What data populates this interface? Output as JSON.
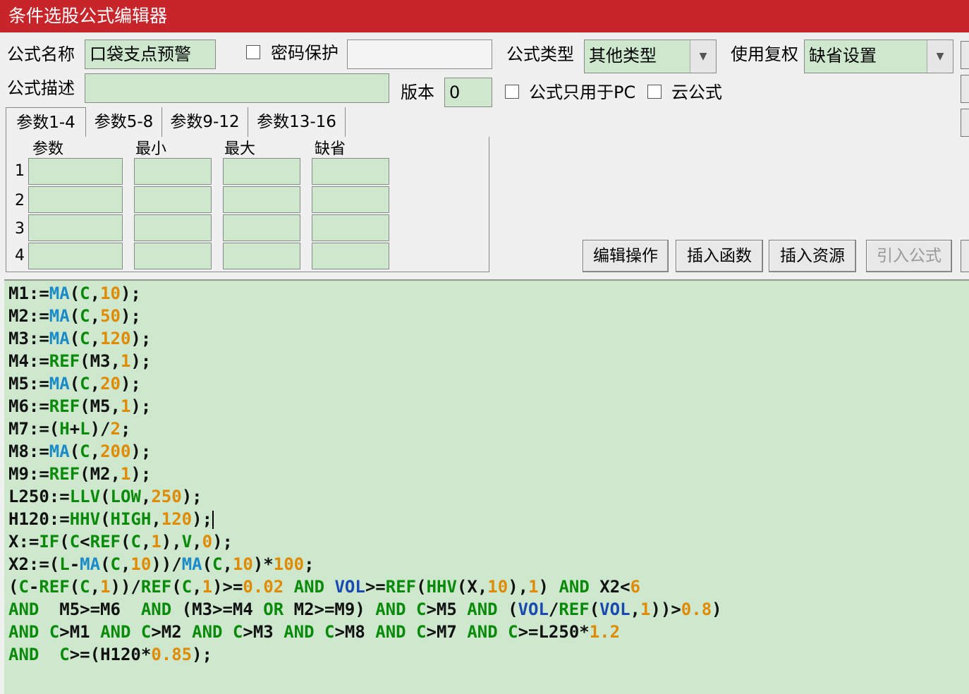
{
  "window": {
    "title": "条件选股公式编辑器"
  },
  "form": {
    "name_label": "公式名称",
    "name_value": "口袋支点预警",
    "password_label": "密码保护",
    "type_label": "公式类型",
    "type_value": "其他类型",
    "rights_label": "使用复权",
    "rights_value": "缺省设置",
    "desc_label": "公式描述",
    "desc_value": "",
    "version_label": "版本",
    "version_value": "0",
    "pc_only_label": "公式只用于PC",
    "cloud_label": "云公式"
  },
  "tabs": [
    "参数1-4",
    "参数5-8",
    "参数9-12",
    "参数13-16"
  ],
  "params": {
    "headers": [
      "参数",
      "最小",
      "最大",
      "缺省"
    ],
    "rows": [
      "1",
      "2",
      "3",
      "4"
    ]
  },
  "buttons": {
    "edit": "编辑操作",
    "insert_func": "插入函数",
    "insert_res": "插入资源",
    "import": "引入公式"
  },
  "code_lines": [
    [
      [
        "M1:=",
        "k"
      ],
      [
        "MA",
        "c"
      ],
      [
        "(",
        "k"
      ],
      [
        "C",
        "g"
      ],
      [
        ",",
        "k"
      ],
      [
        "10",
        "o"
      ],
      [
        ");",
        "k"
      ]
    ],
    [
      [
        "M2:=",
        "k"
      ],
      [
        "MA",
        "c"
      ],
      [
        "(",
        "k"
      ],
      [
        "C",
        "g"
      ],
      [
        ",",
        "k"
      ],
      [
        "50",
        "o"
      ],
      [
        ");",
        "k"
      ]
    ],
    [
      [
        "M3:=",
        "k"
      ],
      [
        "MA",
        "c"
      ],
      [
        "(",
        "k"
      ],
      [
        "C",
        "g"
      ],
      [
        ",",
        "k"
      ],
      [
        "120",
        "o"
      ],
      [
        ");",
        "k"
      ]
    ],
    [
      [
        "M4:=",
        "k"
      ],
      [
        "REF",
        "g"
      ],
      [
        "(M3,",
        "k"
      ],
      [
        "1",
        "o"
      ],
      [
        ");",
        "k"
      ]
    ],
    [
      [
        "M5:=",
        "k"
      ],
      [
        "MA",
        "c"
      ],
      [
        "(",
        "k"
      ],
      [
        "C",
        "g"
      ],
      [
        ",",
        "k"
      ],
      [
        "20",
        "o"
      ],
      [
        ");",
        "k"
      ]
    ],
    [
      [
        "M6:=",
        "k"
      ],
      [
        "REF",
        "g"
      ],
      [
        "(M5,",
        "k"
      ],
      [
        "1",
        "o"
      ],
      [
        ");",
        "k"
      ]
    ],
    [
      [
        "M7:=(",
        "k"
      ],
      [
        "H",
        "g"
      ],
      [
        "+",
        "k"
      ],
      [
        "L",
        "g"
      ],
      [
        ")/",
        "k"
      ],
      [
        "2",
        "o"
      ],
      [
        ";",
        "k"
      ]
    ],
    [
      [
        "M8:=",
        "k"
      ],
      [
        "MA",
        "c"
      ],
      [
        "(",
        "k"
      ],
      [
        "C",
        "g"
      ],
      [
        ",",
        "k"
      ],
      [
        "200",
        "o"
      ],
      [
        ");",
        "k"
      ]
    ],
    [
      [
        "M9:=",
        "k"
      ],
      [
        "REF",
        "g"
      ],
      [
        "(M2,",
        "k"
      ],
      [
        "1",
        "o"
      ],
      [
        ");",
        "k"
      ]
    ],
    [
      [
        "L250:=",
        "k"
      ],
      [
        "LLV",
        "g"
      ],
      [
        "(",
        "k"
      ],
      [
        "LOW",
        "g"
      ],
      [
        ",",
        "k"
      ],
      [
        "250",
        "o"
      ],
      [
        ");",
        "k"
      ]
    ],
    [
      [
        "H120:=",
        "k"
      ],
      [
        "HHV",
        "g"
      ],
      [
        "(",
        "k"
      ],
      [
        "HIGH",
        "g"
      ],
      [
        ",",
        "k"
      ],
      [
        "120",
        "o"
      ],
      [
        ");",
        "k"
      ]
    ],
    [
      [
        "X:=",
        "k"
      ],
      [
        "IF",
        "g"
      ],
      [
        "(",
        "k"
      ],
      [
        "C",
        "g"
      ],
      [
        "<",
        "k"
      ],
      [
        "REF",
        "g"
      ],
      [
        "(",
        "k"
      ],
      [
        "C",
        "g"
      ],
      [
        ",",
        "k"
      ],
      [
        "1",
        "o"
      ],
      [
        "),",
        "k"
      ],
      [
        "V",
        "g"
      ],
      [
        ",",
        "k"
      ],
      [
        "0",
        "o"
      ],
      [
        ");",
        "k"
      ]
    ],
    [
      [
        "X2:=(",
        "k"
      ],
      [
        "L",
        "g"
      ],
      [
        "-",
        "k"
      ],
      [
        "MA",
        "c"
      ],
      [
        "(",
        "k"
      ],
      [
        "C",
        "g"
      ],
      [
        ",",
        "k"
      ],
      [
        "10",
        "o"
      ],
      [
        "))/",
        "k"
      ],
      [
        "MA",
        "c"
      ],
      [
        "(",
        "k"
      ],
      [
        "C",
        "g"
      ],
      [
        ",",
        "k"
      ],
      [
        "10",
        "o"
      ],
      [
        ")*",
        "k"
      ],
      [
        "100",
        "o"
      ],
      [
        ";",
        "k"
      ]
    ],
    [
      [
        "(",
        "k"
      ],
      [
        "C",
        "g"
      ],
      [
        "-",
        "k"
      ],
      [
        "REF",
        "g"
      ],
      [
        "(",
        "k"
      ],
      [
        "C",
        "g"
      ],
      [
        ",",
        "k"
      ],
      [
        "1",
        "o"
      ],
      [
        "))/",
        "k"
      ],
      [
        "REF",
        "g"
      ],
      [
        "(",
        "k"
      ],
      [
        "C",
        "g"
      ],
      [
        ",",
        "k"
      ],
      [
        "1",
        "o"
      ],
      [
        ")>=",
        "k"
      ],
      [
        "0.02",
        "o"
      ],
      [
        " ",
        "k"
      ],
      [
        "AND",
        "g"
      ],
      [
        " ",
        "k"
      ],
      [
        "VOL",
        "b"
      ],
      [
        ">=",
        "k"
      ],
      [
        "REF",
        "g"
      ],
      [
        "(",
        "k"
      ],
      [
        "HHV",
        "g"
      ],
      [
        "(X,",
        "k"
      ],
      [
        "10",
        "o"
      ],
      [
        "),",
        "k"
      ],
      [
        "1",
        "o"
      ],
      [
        ")",
        "k"
      ],
      [
        " AND",
        "g"
      ],
      [
        " X2<",
        "k"
      ],
      [
        "6",
        "o"
      ]
    ],
    [
      [
        "AND",
        "g"
      ],
      [
        "  M5>=M6  ",
        "k"
      ],
      [
        "AND",
        "g"
      ],
      [
        " (M3>=M4 ",
        "k"
      ],
      [
        "OR",
        "g"
      ],
      [
        " M2>=M9) ",
        "k"
      ],
      [
        "AND",
        "g"
      ],
      [
        " ",
        "k"
      ],
      [
        "C",
        "g"
      ],
      [
        ">M5 ",
        "k"
      ],
      [
        "AND",
        "g"
      ],
      [
        " (",
        "k"
      ],
      [
        "VOL",
        "b"
      ],
      [
        "/",
        "k"
      ],
      [
        "REF",
        "g"
      ],
      [
        "(",
        "k"
      ],
      [
        "VOL",
        "b"
      ],
      [
        ",",
        "k"
      ],
      [
        "1",
        "o"
      ],
      [
        "))>",
        "k"
      ],
      [
        "0.8",
        "o"
      ],
      [
        ")",
        "k"
      ]
    ],
    [
      [
        "AND",
        "g"
      ],
      [
        " ",
        "k"
      ],
      [
        "C",
        "g"
      ],
      [
        ">M1 ",
        "k"
      ],
      [
        "AND",
        "g"
      ],
      [
        " ",
        "k"
      ],
      [
        "C",
        "g"
      ],
      [
        ">M2 ",
        "k"
      ],
      [
        "AND",
        "g"
      ],
      [
        " ",
        "k"
      ],
      [
        "C",
        "g"
      ],
      [
        ">M3 ",
        "k"
      ],
      [
        "AND",
        "g"
      ],
      [
        " ",
        "k"
      ],
      [
        "C",
        "g"
      ],
      [
        ">M8 ",
        "k"
      ],
      [
        "AND",
        "g"
      ],
      [
        " ",
        "k"
      ],
      [
        "C",
        "g"
      ],
      [
        ">M7 ",
        "k"
      ],
      [
        "AND",
        "g"
      ],
      [
        " ",
        "k"
      ],
      [
        "C",
        "g"
      ],
      [
        ">=L250*",
        "k"
      ],
      [
        "1.2",
        "o"
      ]
    ],
    [
      [
        "AND",
        "g"
      ],
      [
        "  ",
        "k"
      ],
      [
        "C",
        "g"
      ],
      [
        ">=(H120*",
        "k"
      ],
      [
        "0.85",
        "o"
      ],
      [
        ");",
        "k"
      ]
    ]
  ]
}
